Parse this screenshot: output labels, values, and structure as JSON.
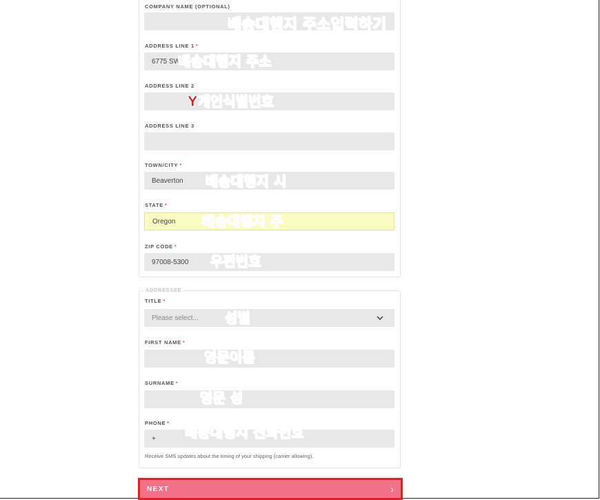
{
  "form": {
    "address_fields": [
      {
        "label": "COMPANY NAME (OPTIONAL)",
        "required": false,
        "value": ""
      },
      {
        "label": "ADDRESS LINE 1",
        "required": true,
        "value": "6775 SW"
      },
      {
        "label": "ADDRESS LINE 2",
        "required": false,
        "value": ""
      },
      {
        "label": "ADDRESS LINE 3",
        "required": false,
        "value": ""
      },
      {
        "label": "TOWN/CITY",
        "required": true,
        "value": "Beaverton"
      },
      {
        "label": "STATE",
        "required": true,
        "value": "Oregon"
      },
      {
        "label": "ZIP CODE",
        "required": true,
        "value": "97008-5300"
      }
    ],
    "required_mark": "*",
    "addressee": {
      "legend": "ADDRESSEE",
      "title": {
        "label": "TITLE",
        "placeholder": "Please select..."
      },
      "first_name": {
        "label": "FIRST NAME",
        "value": ""
      },
      "surname": {
        "label": "SURNAME",
        "value": ""
      },
      "phone": {
        "label": "PHONE",
        "value": "+"
      },
      "sms_note": "Receive SMS updates about the timing of your shipping (carrier allowing)."
    },
    "next_button": {
      "label": "NEXT",
      "arrow": "›"
    }
  },
  "overlays": {
    "company": "배송대행지 주소입력하기",
    "address1": "배송대행지 주소",
    "address2": "Y개인식별번호",
    "city": "배송대행지 시",
    "state": "배송대행지 주",
    "zip": "우편번호",
    "title": "성별",
    "first_name": "영문이름",
    "surname": "영문 성",
    "phone": "배송대행지 전화번호"
  },
  "colors": {
    "overlay_red": "#d81f26",
    "overlay_blue": "#1aa7d6",
    "next_button_bg": "#f27187",
    "autofill_bg": "#fbfbc4"
  },
  "icons": {
    "select": "chevron-down-icon",
    "next": "chevron-right-icon"
  }
}
